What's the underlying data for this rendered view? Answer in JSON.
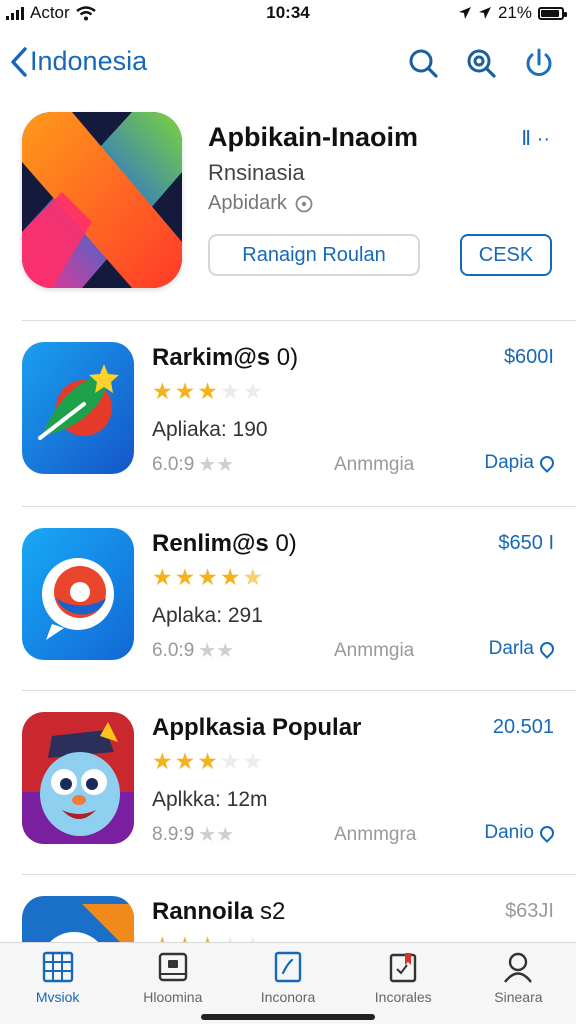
{
  "status": {
    "carrier": "Actor",
    "time": "10:34",
    "battery": "21%"
  },
  "nav": {
    "back_label": "Indonesia",
    "icons": [
      "search-icon",
      "zoom-search-icon",
      "refresh-icon"
    ]
  },
  "featured": {
    "title": "Apbikain-Inaoim",
    "subtitle": "Rnsinasia",
    "category": "Apbidark",
    "primary_button": "Ranaign Roulan",
    "secondary_button": "CESK",
    "share_label": "Ⅱ ··"
  },
  "rows": [
    {
      "title": "Rarkim@s",
      "suffix": "0)",
      "price": "$600I",
      "stars_filled": 3,
      "meta": "Apliaka: 190",
      "rating": "6.0:9",
      "category": "Anmmgia",
      "link": "Dapia"
    },
    {
      "title": "Renlim@s",
      "suffix": "0)",
      "price": "$650 I",
      "stars_filled": 4,
      "meta": "Aplaka: 291",
      "rating": "6.0:9",
      "category": "Anmmgia",
      "link": "Darla"
    },
    {
      "title": "Applkasia Popular",
      "suffix": "",
      "price": "20.501",
      "stars_filled": 3,
      "meta": "Aplkka: 12m",
      "rating": "8.9:9",
      "category": "Anmmgra",
      "link": "Danio"
    },
    {
      "title": "Rannoila",
      "suffix": "s2",
      "price": "$63JI",
      "stars_filled": 3,
      "meta": "",
      "rating": "",
      "category": "",
      "link": ""
    }
  ],
  "tabs": [
    {
      "label": "Mvsiok",
      "icon": "grid-icon",
      "active": true
    },
    {
      "label": "Hloomina",
      "icon": "inbox-icon",
      "active": false
    },
    {
      "label": "Inconora",
      "icon": "edit-icon",
      "active": false
    },
    {
      "label": "Incorales",
      "icon": "bookmark-icon",
      "active": false
    },
    {
      "label": "Sineara",
      "icon": "person-icon",
      "active": false
    }
  ],
  "colors": {
    "accent": "#1669b8",
    "star": "#f5b21b"
  }
}
